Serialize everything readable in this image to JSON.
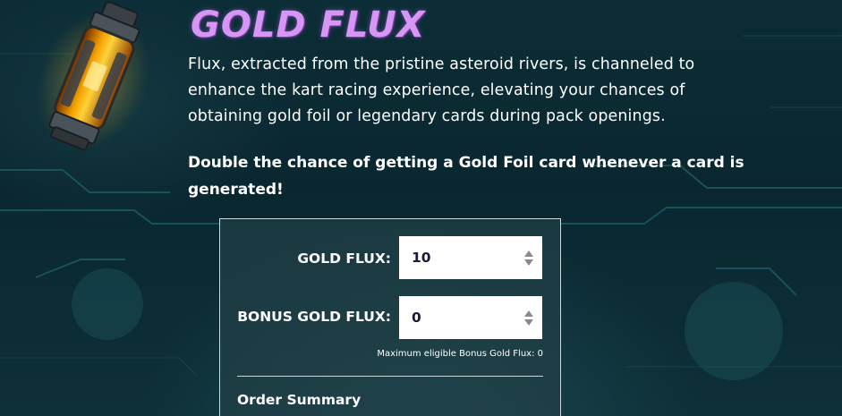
{
  "product": {
    "title": "GOLD FLUX",
    "description": "Flux, extracted from the pristine asteroid rivers, is channeled to enhance the kart racing experience, elevating your chances of obtaining gold foil or legendary cards during pack openings.",
    "highlight": "Double the chance of getting a Gold Foil card whenever a card is generated!",
    "image_icon": "gold-flux-canister"
  },
  "order_form": {
    "gold_flux": {
      "label": "GOLD FLUX:",
      "value": "10"
    },
    "bonus_gold_flux": {
      "label": "BONUS GOLD FLUX:",
      "value": "0"
    },
    "max_bonus_note": "Maximum eligible Bonus Gold Flux: 0",
    "summary_title": "Order Summary"
  },
  "colors": {
    "title": "#d795f5",
    "background": "#0b2a33",
    "panel_border": "#c9d9dc",
    "input_text": "#1e1a3a"
  }
}
